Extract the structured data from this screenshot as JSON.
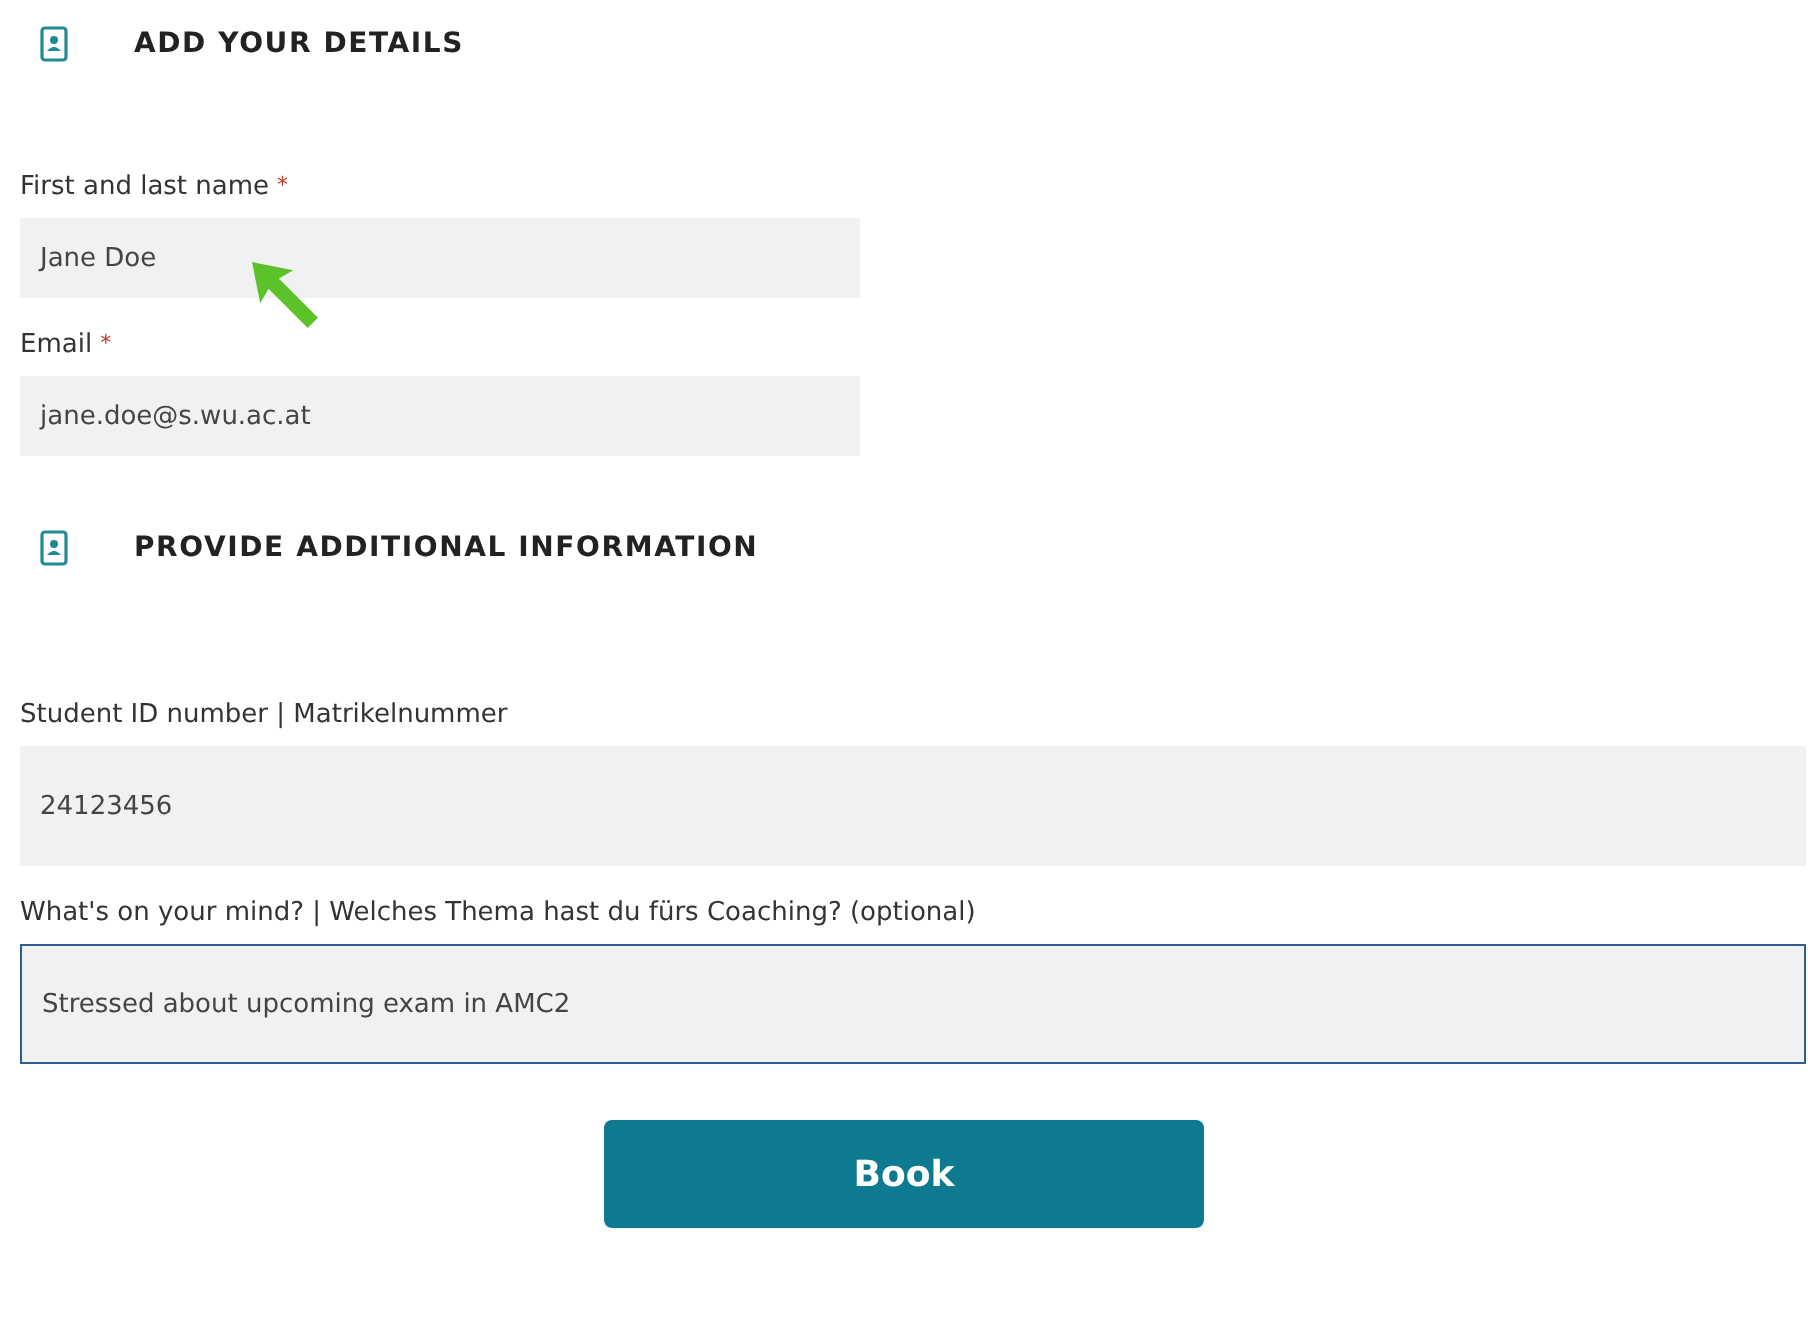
{
  "sections": [
    {
      "heading": "ADD YOUR DETAILS",
      "fields": [
        {
          "label": "First and last name",
          "required_mark": "*",
          "value": "Jane Doe",
          "kind": "half",
          "focused": false,
          "pointer": true
        },
        {
          "label": "Email",
          "required_mark": "*",
          "value": "jane.doe@s.wu.ac.at",
          "kind": "half",
          "focused": false
        }
      ]
    },
    {
      "heading": "PROVIDE ADDITIONAL INFORMATION",
      "fields": [
        {
          "label": "Student ID number | Matrikelnummer",
          "value": "24123456",
          "kind": "full",
          "focused": false
        },
        {
          "label": "What's on your mind? | Welches Thema hast du fürs Coaching? (optional)",
          "value": "Stressed about upcoming exam in AMC2",
          "kind": "full",
          "focused": true
        }
      ]
    }
  ],
  "button": "Book"
}
